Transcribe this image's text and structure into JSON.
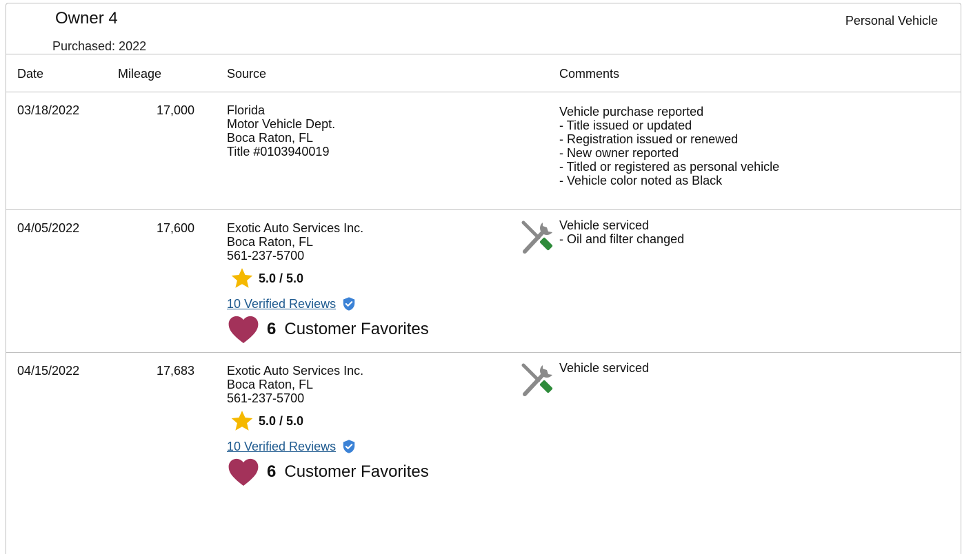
{
  "owner": {
    "title": "Owner 4",
    "purchased": "Purchased: 2022",
    "vehicle_type": "Personal Vehicle"
  },
  "columns": {
    "date": "Date",
    "mileage": "Mileage",
    "source": "Source",
    "comments": "Comments"
  },
  "records": [
    {
      "date": "03/18/2022",
      "mileage": "17,000",
      "source": [
        "Florida",
        "Motor Vehicle Dept.",
        "Boca Raton, FL",
        "Title #0103940019"
      ],
      "comment_title": "Vehicle purchase reported",
      "comment_lines": [
        "- Title issued or updated",
        "- Registration issued or renewed",
        "- New owner reported",
        "- Titled or registered as personal vehicle",
        "- Vehicle color noted as Black"
      ]
    },
    {
      "date": "04/05/2022",
      "mileage": "17,600",
      "source": [
        "Exotic Auto Services Inc.",
        "Boca Raton, FL",
        "561-237-5700"
      ],
      "rating": "5.0 / 5.0",
      "reviews": "10 Verified Reviews",
      "favorites_count": "6",
      "favorites_label": "Customer Favorites",
      "comment_title": "Vehicle serviced",
      "comment_lines": [
        "- Oil and filter changed"
      ]
    },
    {
      "date": "04/15/2022",
      "mileage": "17,683",
      "source": [
        "Exotic Auto Services Inc.",
        "Boca Raton, FL",
        "561-237-5700"
      ],
      "rating": "5.0 / 5.0",
      "reviews": "10 Verified Reviews",
      "favorites_count": "6",
      "favorites_label": "Customer Favorites",
      "comment_title": "Vehicle serviced",
      "comment_lines": []
    }
  ],
  "icons": {
    "star": "star-icon",
    "verified": "verified-shield-icon",
    "favorite": "heart-icon",
    "service": "wrench-screwdriver-icon"
  },
  "colors": {
    "star": "#f5b800",
    "verified": "#3b82d6",
    "heart": "#a3325a",
    "link": "#1e5a8f",
    "tool_gray": "#8a8a8a",
    "tool_green": "#2e8b3a"
  }
}
